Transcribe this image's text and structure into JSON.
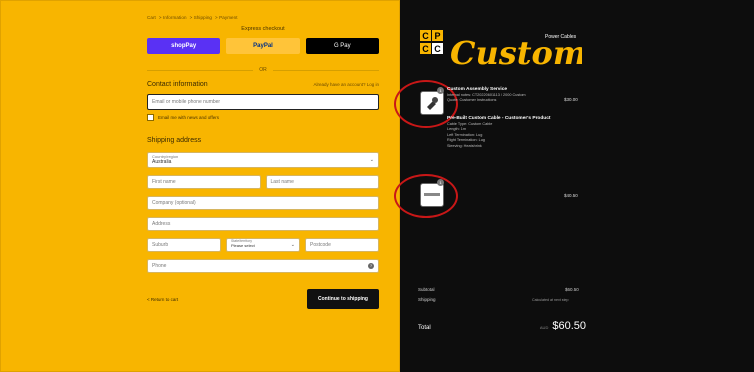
{
  "breadcrumb": [
    "Cart",
    "Information",
    "Shipping",
    "Payment"
  ],
  "express_checkout": {
    "heading": "Express checkout",
    "buttons": [
      "shopPay",
      "PayPal",
      "G Pay"
    ],
    "or_label": "OR"
  },
  "contact": {
    "heading": "Contact information",
    "login_text": "Already have an account? Log in",
    "email_placeholder": "Email or mobile phone number",
    "email_checkbox": "Email me with news and offers"
  },
  "shipping": {
    "heading": "Shipping address",
    "country_label": "Country/region",
    "country_value": "Australia",
    "first_name": "First name",
    "last_name": "Last name",
    "company": "Company (optional)",
    "address": "Address",
    "suburb": "Suburb",
    "state_label": "State/territory",
    "state_value": "Please select",
    "postcode": "Postcode",
    "phone": "Phone"
  },
  "footer": {
    "return_link": "< Return to cart",
    "continue_button": "Continue to shipping"
  },
  "brand": {
    "name": "Custom",
    "sub": "Power Cables",
    "initials": [
      "C",
      "P",
      "C",
      "C"
    ]
  },
  "items": [
    {
      "qty": "1",
      "title": "Custom Assembly Service",
      "lines": [
        "Internal notes: CT20220601113 / 2000 Custom",
        "Quote: Customer Instructions"
      ],
      "price": "$30.00"
    },
    {
      "qty": "1",
      "title": "Pre-Built Custom Cable - Customer's Product",
      "lines": [
        "Cable Type: Custom Cable",
        "Length: 1m",
        "Left Termination: Lug",
        "Right Termination: Lug",
        "Sleeving: Heatshrink"
      ],
      "price": "$40.50"
    }
  ],
  "summary": {
    "subtotal_label": "Subtotal",
    "subtotal_value": "$60.50",
    "shipping_label": "Shipping",
    "shipping_value": "Calculated at next step",
    "total_label": "Total",
    "currency": "AUD",
    "total_value": "$60.50"
  },
  "colors": {
    "left_bg": "#f8b500",
    "right_bg": "#0d0d0d",
    "highlight": "#c81717",
    "shop_pay": "#5a31f4"
  }
}
